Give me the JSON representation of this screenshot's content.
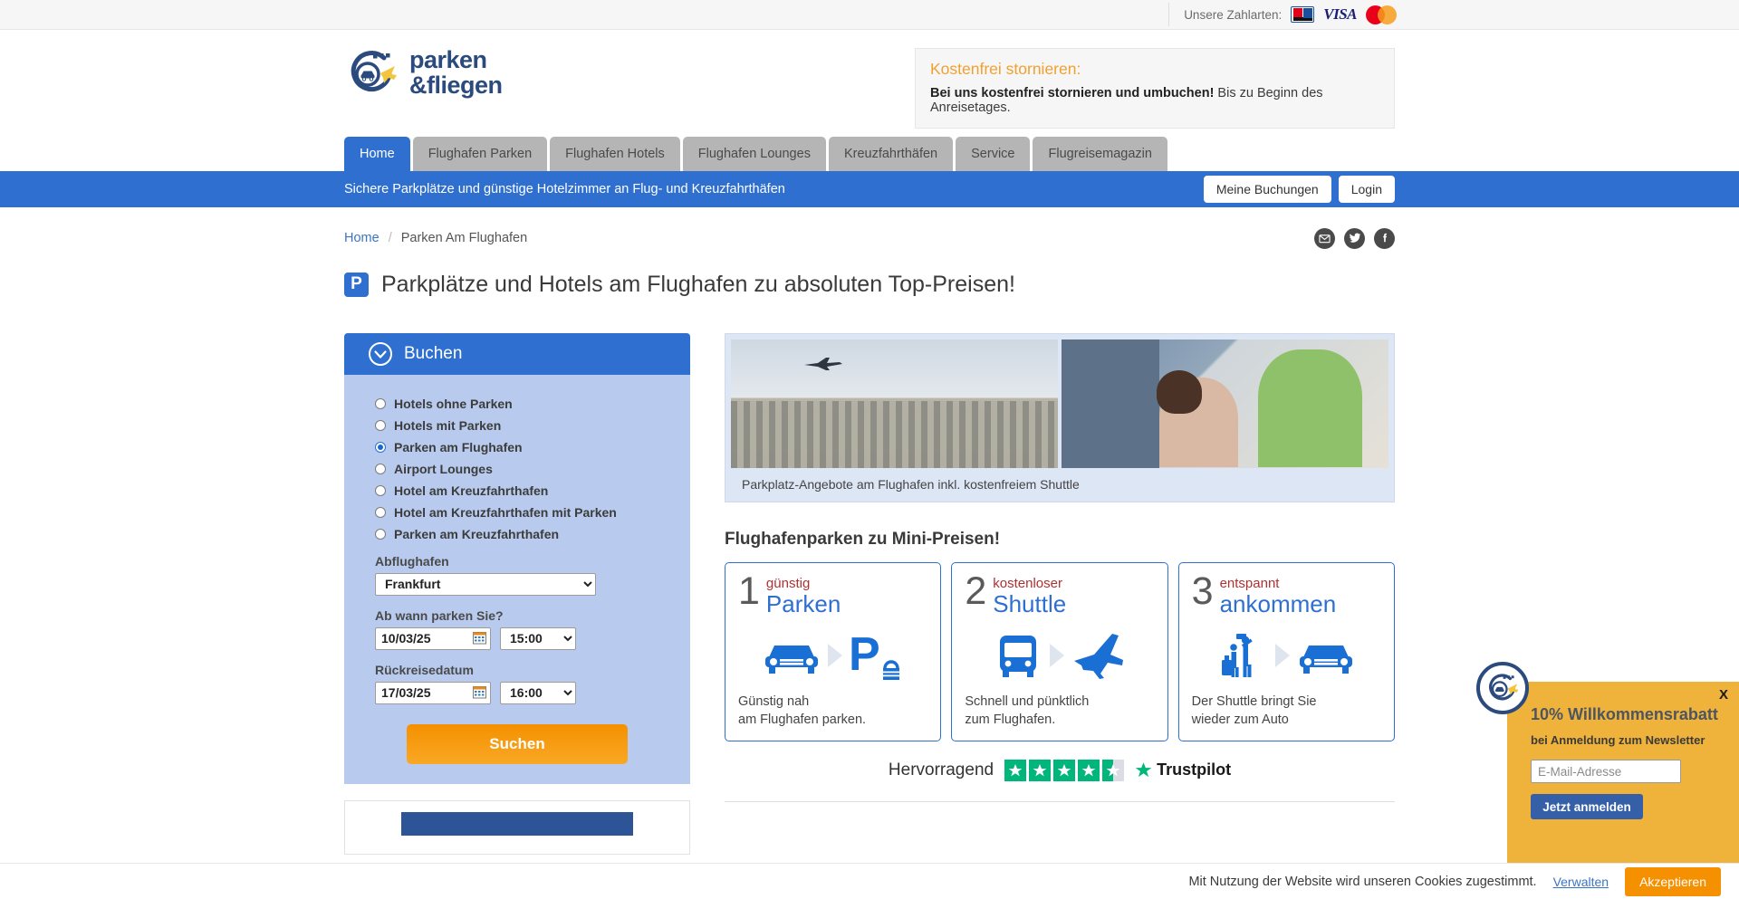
{
  "paybar": {
    "label": "Unsere Zahlarten:",
    "methods": [
      "ec-karte-icon",
      "visa-icon",
      "mastercard-icon"
    ]
  },
  "header": {
    "logo": {
      "line1": "parken",
      "line2": "&fliegen",
      "icon": "car-plane-circle-icon"
    },
    "notice": {
      "heading": "Kostenfrei stornieren:",
      "bold": "Bei uns kostenfrei stornieren und umbuchen!",
      "rest": " Bis zu Beginn des Anreisetages."
    }
  },
  "nav": {
    "tabs": [
      {
        "label": "Home",
        "active": true
      },
      {
        "label": "Flughafen Parken",
        "active": false
      },
      {
        "label": "Flughafen Hotels",
        "active": false
      },
      {
        "label": "Flughafen Lounges",
        "active": false
      },
      {
        "label": "Kreuzfahrthäfen",
        "active": false
      },
      {
        "label": "Service",
        "active": false
      },
      {
        "label": "Flugreisemagazin",
        "active": false
      }
    ]
  },
  "bluebar": {
    "tagline": "Sichere Parkplätze und günstige Hotelzimmer an Flug- und Kreuzfahrthäfen",
    "bookings_label": "Meine Buchungen",
    "login_label": "Login"
  },
  "breadcrumb": {
    "home": "Home",
    "separator": "/",
    "current": "Parken Am Flughafen"
  },
  "socials": [
    "email-icon",
    "twitter-icon",
    "facebook-icon"
  ],
  "page_title": {
    "badge": "P",
    "text": "Parkplätze und Hotels am Flughafen zu absoluten Top-Preisen!"
  },
  "booking": {
    "panel_title": "Buchen",
    "panel_icon": "chevron-down-circle-icon",
    "options": [
      {
        "label": "Hotels ohne Parken",
        "selected": false
      },
      {
        "label": "Hotels mit Parken",
        "selected": false
      },
      {
        "label": "Parken am Flughafen",
        "selected": true
      },
      {
        "label": "Airport Lounges",
        "selected": false
      },
      {
        "label": "Hotel am Kreuzfahrthafen",
        "selected": false
      },
      {
        "label": "Hotel am Kreuzfahrthafen mit Parken",
        "selected": false
      },
      {
        "label": "Parken am Kreuzfahrthafen",
        "selected": false
      }
    ],
    "airport_label": "Abflughafen",
    "airport_value": "Frankfurt",
    "start_label": "Ab wann parken Sie?",
    "start_date": "10/03/25",
    "start_time": "15:00",
    "return_label": "Rückreisedatum",
    "return_date": "17/03/25",
    "return_time": "16:00",
    "search_label": "Suchen"
  },
  "hero": {
    "caption": "Parkplatz-Angebote am Flughafen inkl. kostenfreiem Shuttle"
  },
  "section": {
    "title": "Flughafenparken zu Mini-Preisen!",
    "cards": [
      {
        "number": "1",
        "kicker": "günstig",
        "word": "Parken",
        "icons": [
          "car-icon",
          "arrow-right-icon",
          "parking-lock-icon"
        ],
        "footer": "Günstig nah\nam Flughafen parken."
      },
      {
        "number": "2",
        "kicker": "kostenloser",
        "word": "Shuttle",
        "icons": [
          "bus-icon",
          "arrow-right-icon",
          "airplane-icon"
        ],
        "footer": "Schnell und pünktlich\nzum Flughafen."
      },
      {
        "number": "3",
        "kicker": "entspannt",
        "word": "ankommen",
        "icons": [
          "travelers-icon",
          "arrow-right-icon",
          "car-icon"
        ],
        "footer": "Der Shuttle bringt Sie\nwieder zum Auto"
      }
    ]
  },
  "trustpilot": {
    "word": "Hervorragend",
    "rating": 4.5,
    "max": 5,
    "brand": "Trustpilot",
    "star_color": "#00b67a"
  },
  "newsletter": {
    "close": "X",
    "heading": "10% Willkommensrabatt",
    "subheading": "bei Anmeldung zum Newsletter",
    "placeholder": "E-Mail-Adresse",
    "value": "",
    "button": "Jetzt anmelden",
    "logo": "car-plane-circle-icon"
  },
  "cookie": {
    "text": "Mit Nutzung der Website wird unseren Cookies zugestimmt.",
    "manage": "Verwalten",
    "accept": "Akzeptieren"
  },
  "colors": {
    "primary_blue": "#2e6fd0",
    "panel_blue": "#b8cbee",
    "orange": "#f59000",
    "notice_orange": "#f0a030",
    "newsletter_yellow": "#efb33c",
    "trust_green": "#00b67a",
    "logo_navy": "#2b4a7d"
  }
}
